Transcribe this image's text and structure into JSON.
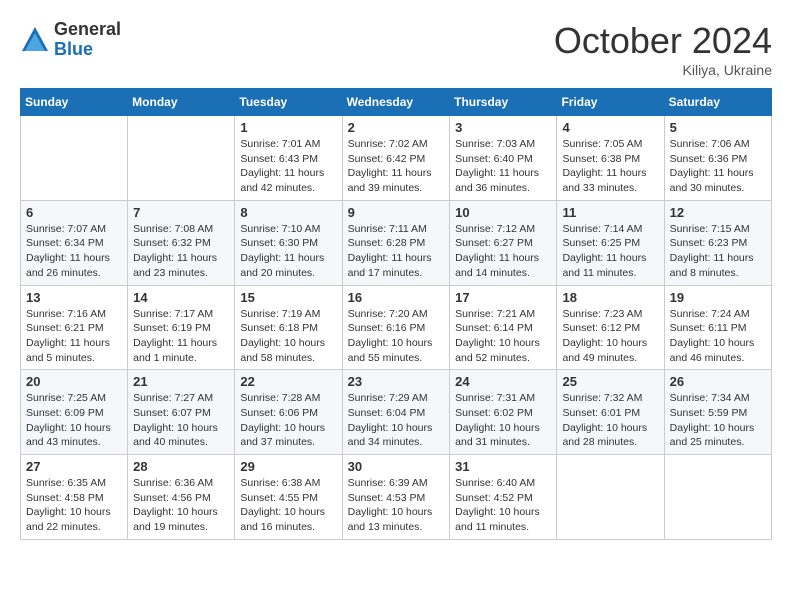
{
  "header": {
    "logo_general": "General",
    "logo_blue": "Blue",
    "month_title": "October 2024",
    "location": "Kiliya, Ukraine"
  },
  "weekdays": [
    "Sunday",
    "Monday",
    "Tuesday",
    "Wednesday",
    "Thursday",
    "Friday",
    "Saturday"
  ],
  "weeks": [
    [
      {
        "day": "",
        "info": ""
      },
      {
        "day": "",
        "info": ""
      },
      {
        "day": "1",
        "info": "Sunrise: 7:01 AM\nSunset: 6:43 PM\nDaylight: 11 hours and 42 minutes."
      },
      {
        "day": "2",
        "info": "Sunrise: 7:02 AM\nSunset: 6:42 PM\nDaylight: 11 hours and 39 minutes."
      },
      {
        "day": "3",
        "info": "Sunrise: 7:03 AM\nSunset: 6:40 PM\nDaylight: 11 hours and 36 minutes."
      },
      {
        "day": "4",
        "info": "Sunrise: 7:05 AM\nSunset: 6:38 PM\nDaylight: 11 hours and 33 minutes."
      },
      {
        "day": "5",
        "info": "Sunrise: 7:06 AM\nSunset: 6:36 PM\nDaylight: 11 hours and 30 minutes."
      }
    ],
    [
      {
        "day": "6",
        "info": "Sunrise: 7:07 AM\nSunset: 6:34 PM\nDaylight: 11 hours and 26 minutes."
      },
      {
        "day": "7",
        "info": "Sunrise: 7:08 AM\nSunset: 6:32 PM\nDaylight: 11 hours and 23 minutes."
      },
      {
        "day": "8",
        "info": "Sunrise: 7:10 AM\nSunset: 6:30 PM\nDaylight: 11 hours and 20 minutes."
      },
      {
        "day": "9",
        "info": "Sunrise: 7:11 AM\nSunset: 6:28 PM\nDaylight: 11 hours and 17 minutes."
      },
      {
        "day": "10",
        "info": "Sunrise: 7:12 AM\nSunset: 6:27 PM\nDaylight: 11 hours and 14 minutes."
      },
      {
        "day": "11",
        "info": "Sunrise: 7:14 AM\nSunset: 6:25 PM\nDaylight: 11 hours and 11 minutes."
      },
      {
        "day": "12",
        "info": "Sunrise: 7:15 AM\nSunset: 6:23 PM\nDaylight: 11 hours and 8 minutes."
      }
    ],
    [
      {
        "day": "13",
        "info": "Sunrise: 7:16 AM\nSunset: 6:21 PM\nDaylight: 11 hours and 5 minutes."
      },
      {
        "day": "14",
        "info": "Sunrise: 7:17 AM\nSunset: 6:19 PM\nDaylight: 11 hours and 1 minute."
      },
      {
        "day": "15",
        "info": "Sunrise: 7:19 AM\nSunset: 6:18 PM\nDaylight: 10 hours and 58 minutes."
      },
      {
        "day": "16",
        "info": "Sunrise: 7:20 AM\nSunset: 6:16 PM\nDaylight: 10 hours and 55 minutes."
      },
      {
        "day": "17",
        "info": "Sunrise: 7:21 AM\nSunset: 6:14 PM\nDaylight: 10 hours and 52 minutes."
      },
      {
        "day": "18",
        "info": "Sunrise: 7:23 AM\nSunset: 6:12 PM\nDaylight: 10 hours and 49 minutes."
      },
      {
        "day": "19",
        "info": "Sunrise: 7:24 AM\nSunset: 6:11 PM\nDaylight: 10 hours and 46 minutes."
      }
    ],
    [
      {
        "day": "20",
        "info": "Sunrise: 7:25 AM\nSunset: 6:09 PM\nDaylight: 10 hours and 43 minutes."
      },
      {
        "day": "21",
        "info": "Sunrise: 7:27 AM\nSunset: 6:07 PM\nDaylight: 10 hours and 40 minutes."
      },
      {
        "day": "22",
        "info": "Sunrise: 7:28 AM\nSunset: 6:06 PM\nDaylight: 10 hours and 37 minutes."
      },
      {
        "day": "23",
        "info": "Sunrise: 7:29 AM\nSunset: 6:04 PM\nDaylight: 10 hours and 34 minutes."
      },
      {
        "day": "24",
        "info": "Sunrise: 7:31 AM\nSunset: 6:02 PM\nDaylight: 10 hours and 31 minutes."
      },
      {
        "day": "25",
        "info": "Sunrise: 7:32 AM\nSunset: 6:01 PM\nDaylight: 10 hours and 28 minutes."
      },
      {
        "day": "26",
        "info": "Sunrise: 7:34 AM\nSunset: 5:59 PM\nDaylight: 10 hours and 25 minutes."
      }
    ],
    [
      {
        "day": "27",
        "info": "Sunrise: 6:35 AM\nSunset: 4:58 PM\nDaylight: 10 hours and 22 minutes."
      },
      {
        "day": "28",
        "info": "Sunrise: 6:36 AM\nSunset: 4:56 PM\nDaylight: 10 hours and 19 minutes."
      },
      {
        "day": "29",
        "info": "Sunrise: 6:38 AM\nSunset: 4:55 PM\nDaylight: 10 hours and 16 minutes."
      },
      {
        "day": "30",
        "info": "Sunrise: 6:39 AM\nSunset: 4:53 PM\nDaylight: 10 hours and 13 minutes."
      },
      {
        "day": "31",
        "info": "Sunrise: 6:40 AM\nSunset: 4:52 PM\nDaylight: 10 hours and 11 minutes."
      },
      {
        "day": "",
        "info": ""
      },
      {
        "day": "",
        "info": ""
      }
    ]
  ]
}
